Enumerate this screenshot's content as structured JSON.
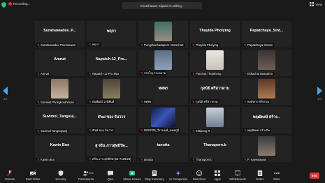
{
  "topbar": {
    "recording": "Recording...",
    "speaking": "Chatchawan Silpakit is talking...",
    "view": "View"
  },
  "tiles": [
    {
      "name": "Suratsawadee_P...",
      "label": "Suratsawadee Promsowan"
    },
    {
      "name": "พฤกา",
      "label": "พฤกา"
    },
    {
      "name": "",
      "label": "Pungchachadaporn Vetrachart"
    },
    {
      "name": "Thayida Pholying",
      "label": "Thayida Pholying"
    },
    {
      "name": "Papatchaya_Sint...",
      "label": "Papatchaya Sintew"
    },
    {
      "name": "Amnat",
      "label": "Amnat"
    },
    {
      "name": "Napatch-12_Pro...",
      "label": "Napatch-12 Pro Max"
    },
    {
      "name": "",
      "label": "จรรโญ กระตลาด"
    },
    {
      "name": "",
      "label": "Panchat Thepthong"
    },
    {
      "name": "",
      "label": "Ekkachai Basudron"
    },
    {
      "name": "",
      "label": "Somkiat Phongkouthiroas"
    },
    {
      "name": "",
      "label": "ธนพัฒน์ วงนิพันธ์"
    },
    {
      "name": "ทศพร",
      "label": "ทศพร"
    },
    {
      "name": "กุลนิธิ ศรีสวาดาม",
      "label": "กุลนิธิ ศรีสวาดาม"
    },
    {
      "name": "",
      "label": "พงษ์สกร ศรีปรวม"
    },
    {
      "name": "Suvimol_Tangsuj...",
      "label": "Suvimol Tangsujapoj"
    },
    {
      "name": "iPad ของ จันวาร",
      "label": "iPad ของ จันวาร"
    },
    {
      "name": "",
      "label": "NOEP09_วีรานนท์_นทศภูมิ"
    },
    {
      "name": "",
      "label": "Kittipong R"
    },
    {
      "name": "พฤฒิพงษ์ สร้าง...",
      "label": "พฤฒิพงษ์ สร้างถิน"
    },
    {
      "name": "Kawin Bun",
      "label": "Kawin Bun"
    },
    {
      "name": "สุ จริน ภาวสุทธิวิพ...",
      "label": "ศรัณ ภาวสุทธิวิพ (01-7106/25)"
    },
    {
      "name": "tanutta",
      "label": "tanutta"
    },
    {
      "name": "Thanaporn.b",
      "label": "Thanaporn.b"
    },
    {
      "name": "",
      "label": "P. Kaewsawan"
    }
  ],
  "pages": {
    "left": "2/7",
    "right": "2/7"
  },
  "toolbar": {
    "unmute": "Unmute",
    "start_video": "Start Video",
    "security": "Security",
    "participants": "Participants",
    "participants_count": "104",
    "qa": "Q&A",
    "share_screen": "Share Screen",
    "stop_summary": "Stop Summary",
    "ai_companion": "AI Companion",
    "reactions": "Reactions",
    "apps": "Apps",
    "whiteboards": "Whiteboards",
    "notes": "Notes",
    "more": "More",
    "end": "End"
  },
  "colors": {
    "accent_green": "#26c281",
    "end_red": "#e0322f",
    "tile_bg": "#232323"
  }
}
